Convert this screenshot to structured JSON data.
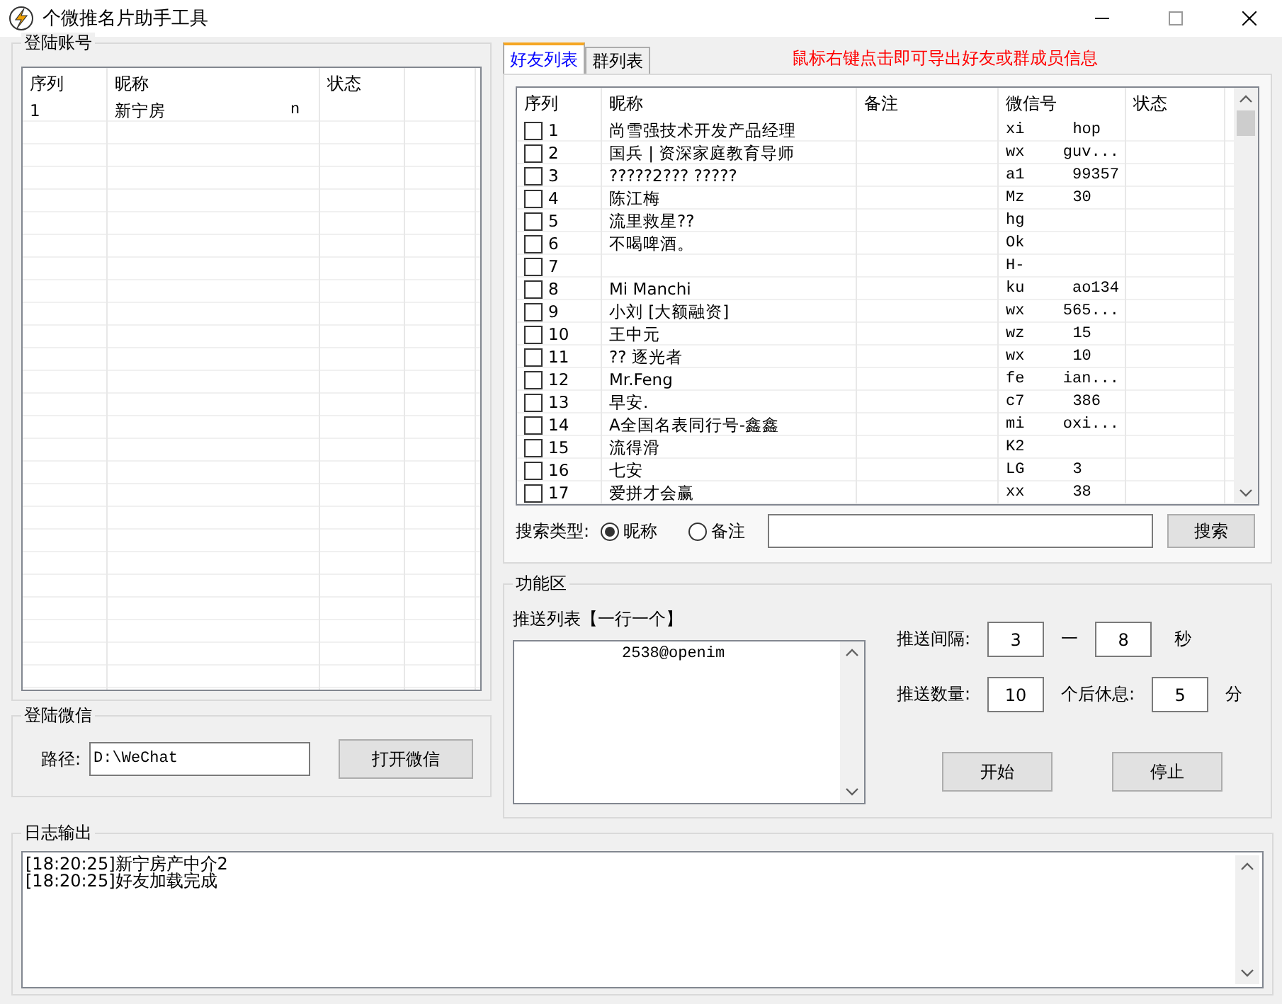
{
  "window": {
    "title": "个微推名片助手工具"
  },
  "login_account": {
    "title": "登陆账号",
    "columns": [
      "序列",
      "昵称",
      "状态"
    ],
    "rows": [
      {
        "index": "1",
        "nickname_head": "新宁房",
        "nickname_tail": "n"
      }
    ]
  },
  "login_wechat": {
    "title": "登陆微信",
    "path_label": "路径:",
    "path": "D:\\WeChat",
    "open_button": "打开微信"
  },
  "tabs": [
    {
      "label": "好友列表",
      "selected": true
    },
    {
      "label": "群列表",
      "selected": false
    }
  ],
  "hint": "鼠标右键点击即可导出好友或群成员信息",
  "friends": {
    "columns": [
      "序列",
      "昵称",
      "备注",
      "微信号",
      "状态"
    ],
    "rows": [
      {
        "index": "1",
        "checked": false,
        "nickname": "尚雪强技术开发产品经理",
        "id_head": "xi",
        "id_tail": "hop"
      },
      {
        "index": "2",
        "checked": false,
        "nickname": "国兵 | 资深家庭教育导师",
        "id_head": "wx",
        "id_tail": "guv..."
      },
      {
        "index": "3",
        "checked": false,
        "nickname": "?????2??? ?????",
        "id_head": "a1",
        "id_tail": "99357"
      },
      {
        "index": "4",
        "checked": false,
        "nickname": "陈江梅",
        "id_head": "Mz",
        "id_tail": "30"
      },
      {
        "index": "5",
        "checked": false,
        "nickname": "流里救星??",
        "id_head": "hg",
        "id_tail": ""
      },
      {
        "index": "6",
        "checked": false,
        "nickname": "不喝啤酒。",
        "id_head": "Ok",
        "id_tail": ""
      },
      {
        "index": "7",
        "checked": false,
        "nickname": "",
        "id_head": "H-",
        "id_tail": ""
      },
      {
        "index": "8",
        "checked": false,
        "nickname": "Mi Manchi",
        "id_head": "ku",
        "id_tail": "ao134"
      },
      {
        "index": "9",
        "checked": false,
        "nickname": "小刘 [大额融资]",
        "id_head": "wx",
        "id_tail": "565..."
      },
      {
        "index": "10",
        "checked": false,
        "nickname": "王中元",
        "id_head": "wz",
        "id_tail": "15"
      },
      {
        "index": "11",
        "checked": false,
        "nickname": "?? 逐光者",
        "id_head": "wx",
        "id_tail": "10"
      },
      {
        "index": "12",
        "checked": false,
        "nickname": "Mr.Feng",
        "id_head": "fe",
        "id_tail": "ian..."
      },
      {
        "index": "13",
        "checked": false,
        "nickname": "早安.",
        "id_head": "c7",
        "id_tail": "386"
      },
      {
        "index": "14",
        "checked": false,
        "nickname": "A全国名表同行号-鑫鑫",
        "id_head": "mi",
        "id_tail": "oxi..."
      },
      {
        "index": "15",
        "checked": false,
        "nickname": "流得滑",
        "id_head": "K2",
        "id_tail": ""
      },
      {
        "index": "16",
        "checked": false,
        "nickname": "七安",
        "id_head": "LG",
        "id_tail": "3"
      },
      {
        "index": "17",
        "checked": false,
        "nickname": "爱拼才会赢",
        "id_head": "xx",
        "id_tail": "38"
      }
    ]
  },
  "search": {
    "label": "搜索类型:",
    "options": [
      {
        "label": "昵称",
        "selected": true
      },
      {
        "label": "备注",
        "selected": false
      }
    ],
    "button": "搜索"
  },
  "function_area": {
    "title": "功能区",
    "push_list_label": "推送列表【一行一个】",
    "push_list": "2538@openim",
    "interval_label": "推送间隔:",
    "interval_min": "3",
    "dash": "一",
    "interval_max": "8",
    "seconds": "秒",
    "count_label": "推送数量:",
    "count": "10",
    "rest_label": "个后休息:",
    "rest": "5",
    "minutes": "分",
    "start_button": "开始",
    "stop_button": "停止"
  },
  "log": {
    "title": "日志输出",
    "lines": [
      "[18:20:25]新宁房产中介2",
      "[18:20:25]好友加载完成"
    ]
  }
}
